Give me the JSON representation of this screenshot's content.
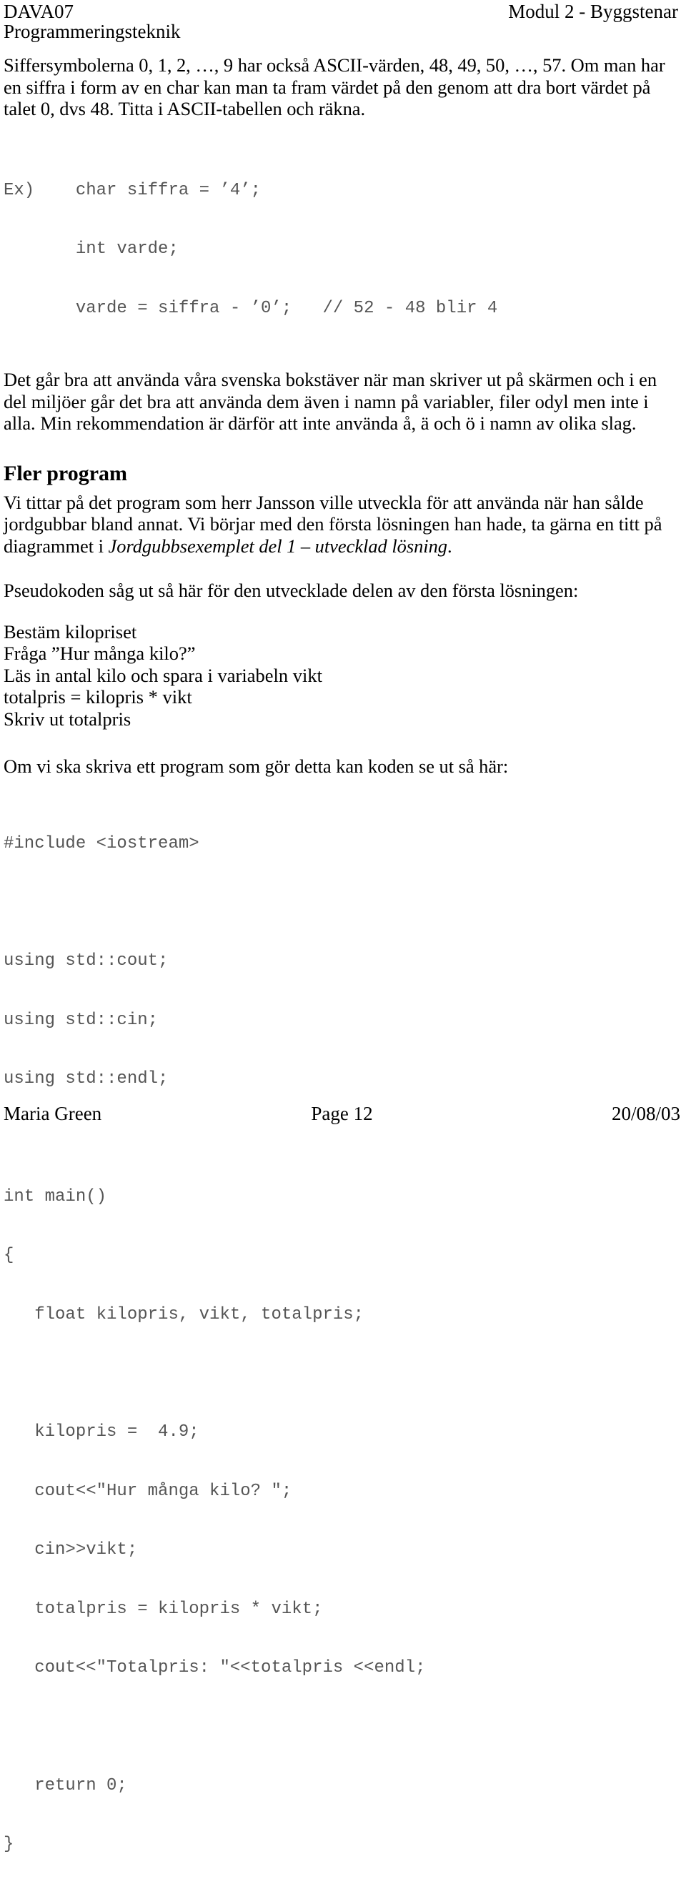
{
  "header": {
    "course_code": "DAVA07",
    "subject": "Programmeringsteknik",
    "module": "Modul 2 - Byggstenar"
  },
  "content": {
    "intro_paragraph": "Siffersymbolerna 0, 1, 2, …, 9 har också ASCII-värden, 48, 49, 50, …, 57. Om man har en siffra i form av en char kan man ta fram värdet på den genom att dra bort värdet på talet 0, dvs 48. Titta i ASCII-tabellen och räkna.",
    "example_code": [
      "Ex)    char siffra = ’4’;",
      "       int varde;",
      "       varde = siffra - ’0’;   // 52 - 48 blir 4"
    ],
    "swedish_chars_paragraph": "Det går bra att använda våra svenska bokstäver när man skriver ut på skärmen och i en del miljöer går det bra att använda dem även i namn på variabler, filer odyl men inte i alla. Min rekommendation är därför att inte använda å, ä och ö i namn av olika slag.",
    "section_heading": "Fler program",
    "jansson_paragraph_part1": "Vi tittar på det program som herr Jansson ville utveckla för att använda när han sålde jordgubbar bland annat. Vi börjar med den första lösningen han hade, ta gärna en titt på diagrammet i ",
    "jansson_paragraph_italic": "Jordgubbsexemplet del 1 – utvecklad lösning",
    "jansson_paragraph_part2": ".",
    "pseudocode_intro": "Pseudokoden såg ut så här för den utvecklade delen av den första lösningen:",
    "pseudocode_lines": [
      "Bestäm kilopriset",
      "Fråga ”Hur många kilo?”",
      "Läs in antal kilo och spara i variabeln vikt",
      "totalpris = kilopris * vikt",
      "Skriv ut totalpris"
    ],
    "program_intro": "Om vi ska skriva ett program som gör detta kan koden se ut så här:",
    "program_code": [
      "#include <iostream>",
      "",
      "using std::cout;",
      "using std::cin;",
      "using std::endl;",
      "",
      "int main()",
      "{",
      "   float kilopris, vikt, totalpris;",
      "",
      "   kilopris =  4.9;",
      "   cout<<\"Hur många kilo? \";",
      "   cin>>vikt;",
      "   totalpris = kilopris * vikt;",
      "   cout<<\"Totalpris: \"<<totalpris <<endl;",
      "",
      "   return 0;",
      "}"
    ]
  },
  "footer": {
    "author": "Maria Green",
    "page": "Page 12",
    "date": "20/08/03"
  }
}
